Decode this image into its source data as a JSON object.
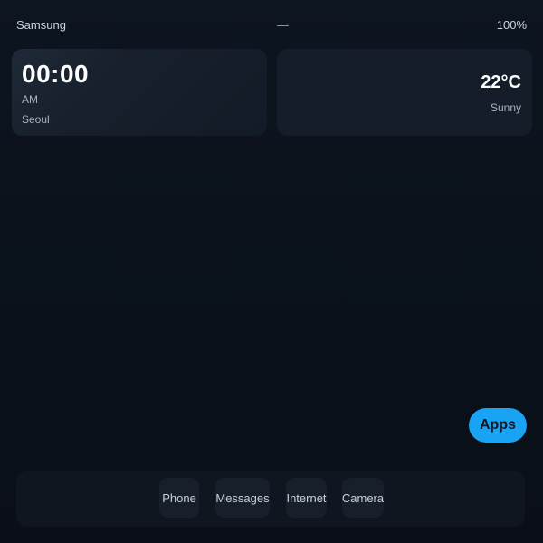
{
  "status_bar": {
    "carrier": "Samsung",
    "center": "—",
    "battery": "100%"
  },
  "clock_widget": {
    "time": "00:00",
    "ampm": "AM",
    "city": "Seoul"
  },
  "weather_widget": {
    "temperature": "22°C",
    "condition": "Sunny"
  },
  "apps_button": {
    "label": "Apps",
    "color": "#19a3f2"
  },
  "dock": {
    "items": [
      {
        "label": "Phone"
      },
      {
        "label": "Messages"
      },
      {
        "label": "Internet"
      },
      {
        "label": "Camera"
      }
    ]
  }
}
